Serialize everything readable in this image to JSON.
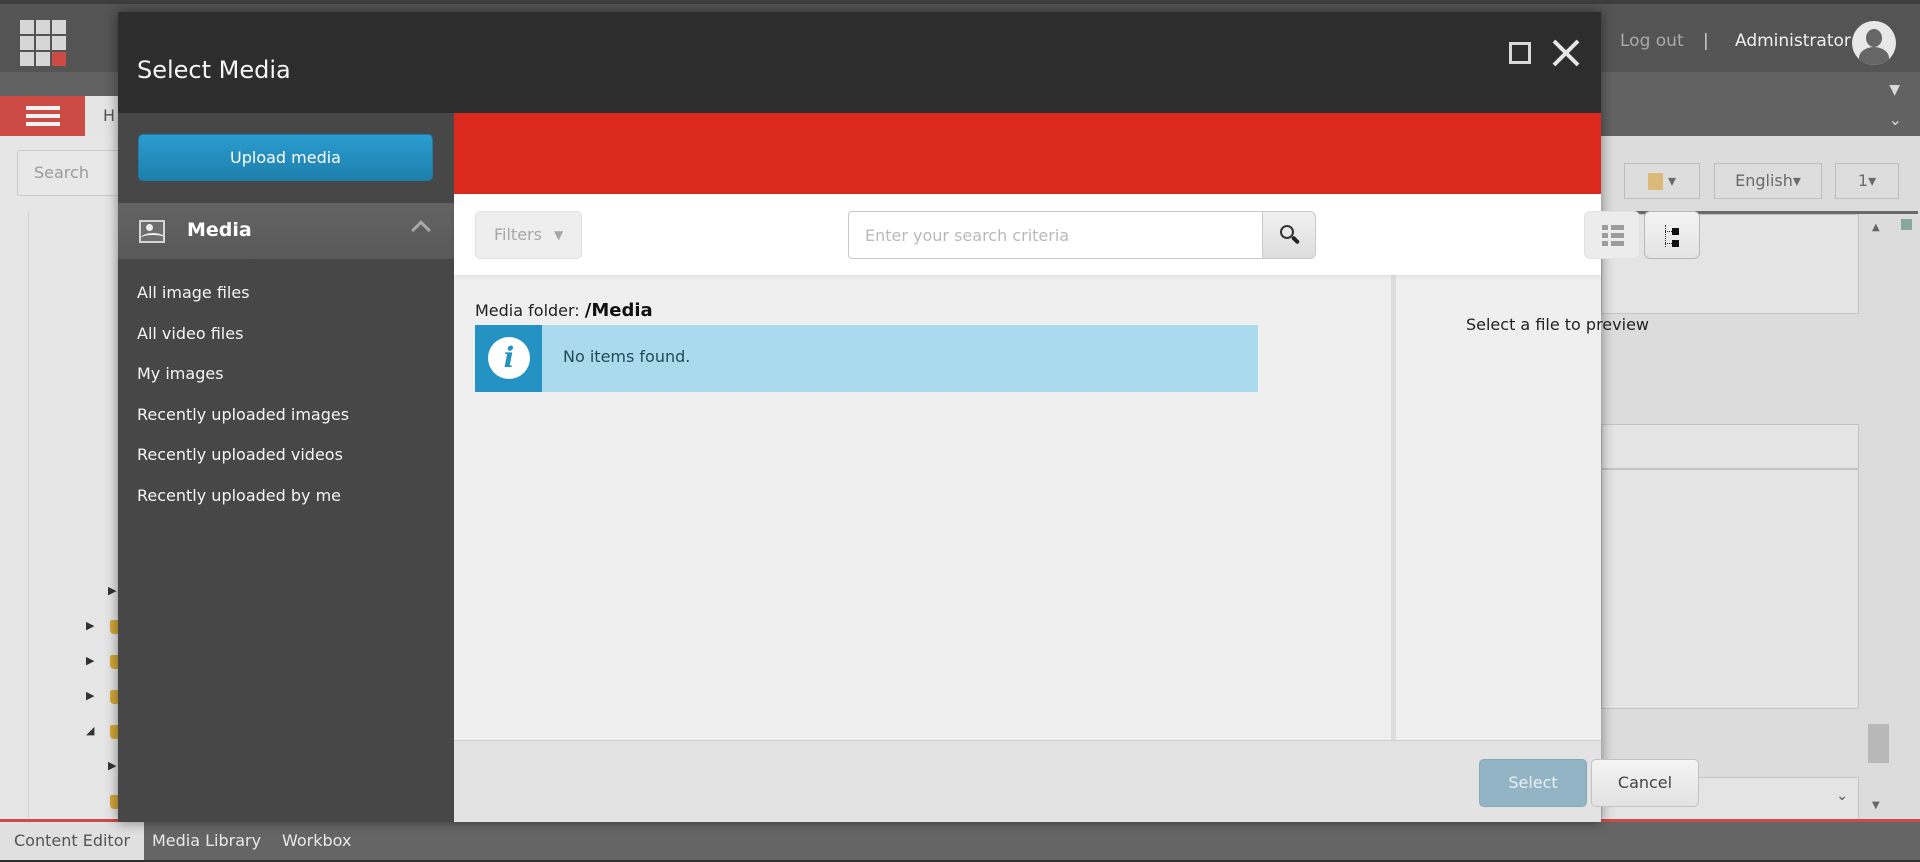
{
  "background": {
    "topbar": {
      "logout_label": "Log out",
      "separator": "|",
      "user_name": "Administrator"
    },
    "ribbon": {
      "home_tab_label": "H"
    },
    "search": {
      "placeholder": "Search"
    },
    "toolbar": {
      "language": "English",
      "language_caret": "▾",
      "version": "1",
      "version_caret": "▾",
      "notes_caret": "▾"
    },
    "taskbar": {
      "tabs": [
        {
          "label": "Content Editor",
          "active": true
        },
        {
          "label": "Media Library",
          "active": false
        },
        {
          "label": "Workbox",
          "active": false
        }
      ]
    }
  },
  "modal": {
    "title": "Select Media",
    "sidebar": {
      "upload_label": "Upload media",
      "section_label": "Media",
      "items": [
        {
          "label": "All image files"
        },
        {
          "label": "All video files"
        },
        {
          "label": "My images"
        },
        {
          "label": "Recently uploaded images"
        },
        {
          "label": "Recently uploaded videos"
        },
        {
          "label": "Recently uploaded by me"
        }
      ]
    },
    "toolbar": {
      "filters_label": "Filters",
      "filters_caret": "▼",
      "search_placeholder": "Enter your search criteria",
      "search_value": ""
    },
    "content": {
      "folder_label": "Media folder:",
      "folder_path": "/Media",
      "info_icon": "i",
      "message": "No items found."
    },
    "preview": {
      "text": "Select a file to preview"
    },
    "footer": {
      "select_label": "Select",
      "cancel_label": "Cancel"
    },
    "colors": {
      "header": "#2d2d2d",
      "accent_bar": "#dc291e",
      "upload_button": "#2592c4",
      "info_background": "#a9daee",
      "info_icon_background": "#2492c2",
      "select_button": "#93b4c4"
    }
  }
}
